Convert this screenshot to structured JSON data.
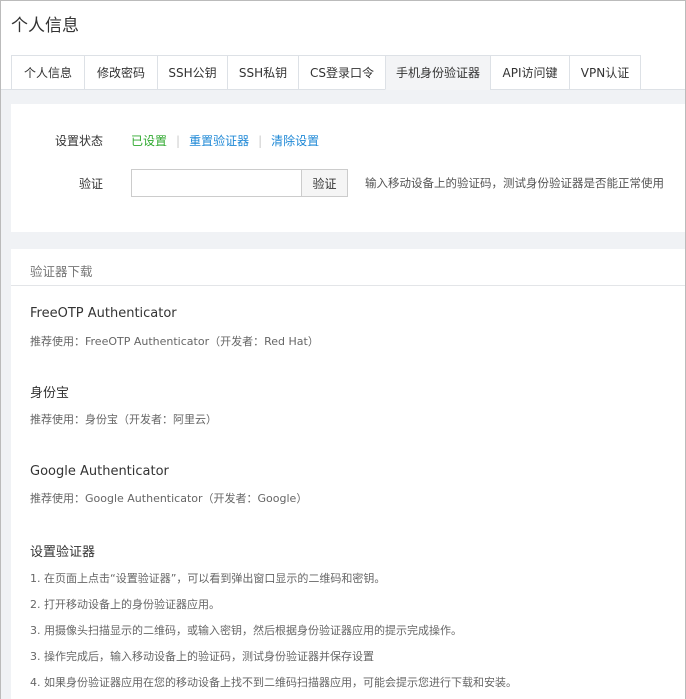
{
  "title": "个人信息",
  "tabs": [
    "个人信息",
    "修改密码",
    "SSH公钥",
    "SSH私钥",
    "CS登录口令",
    "手机身份验证器",
    "API访问键",
    "VPN认证"
  ],
  "status": {
    "label": "设置状态",
    "value": "已设置",
    "reset": "重置验证器",
    "clear": "清除设置"
  },
  "verify": {
    "label": "验证",
    "value": "",
    "button": "验证",
    "hint": "输入移动设备上的验证码，测试身份验证器是否能正常使用"
  },
  "download": {
    "header": "验证器下载",
    "apps": [
      {
        "name": "FreeOTP Authenticator",
        "desc": "推荐使用：FreeOTP Authenticator（开发者：Red Hat）"
      },
      {
        "name": "身份宝",
        "desc": "推荐使用：身份宝（开发者：阿里云）"
      },
      {
        "name": "Google Authenticator",
        "desc": "推荐使用：Google Authenticator（开发者：Google）"
      }
    ]
  },
  "setup": {
    "title": "设置验证器",
    "steps": [
      "1. 在页面上点击“设置验证器”，可以看到弹出窗口显示的二维码和密钥。",
      "2. 打开移动设备上的身份验证器应用。",
      "3. 用摄像头扫描显示的二维码，或输入密钥，然后根据身份验证器应用的提示完成操作。",
      "3. 操作完成后，输入移动设备上的验证码，测试身份验证器并保存设置",
      "4. 如果身份验证器应用在您的移动设备上找不到二维码扫描器应用，可能会提示您进行下载和安装。"
    ]
  }
}
